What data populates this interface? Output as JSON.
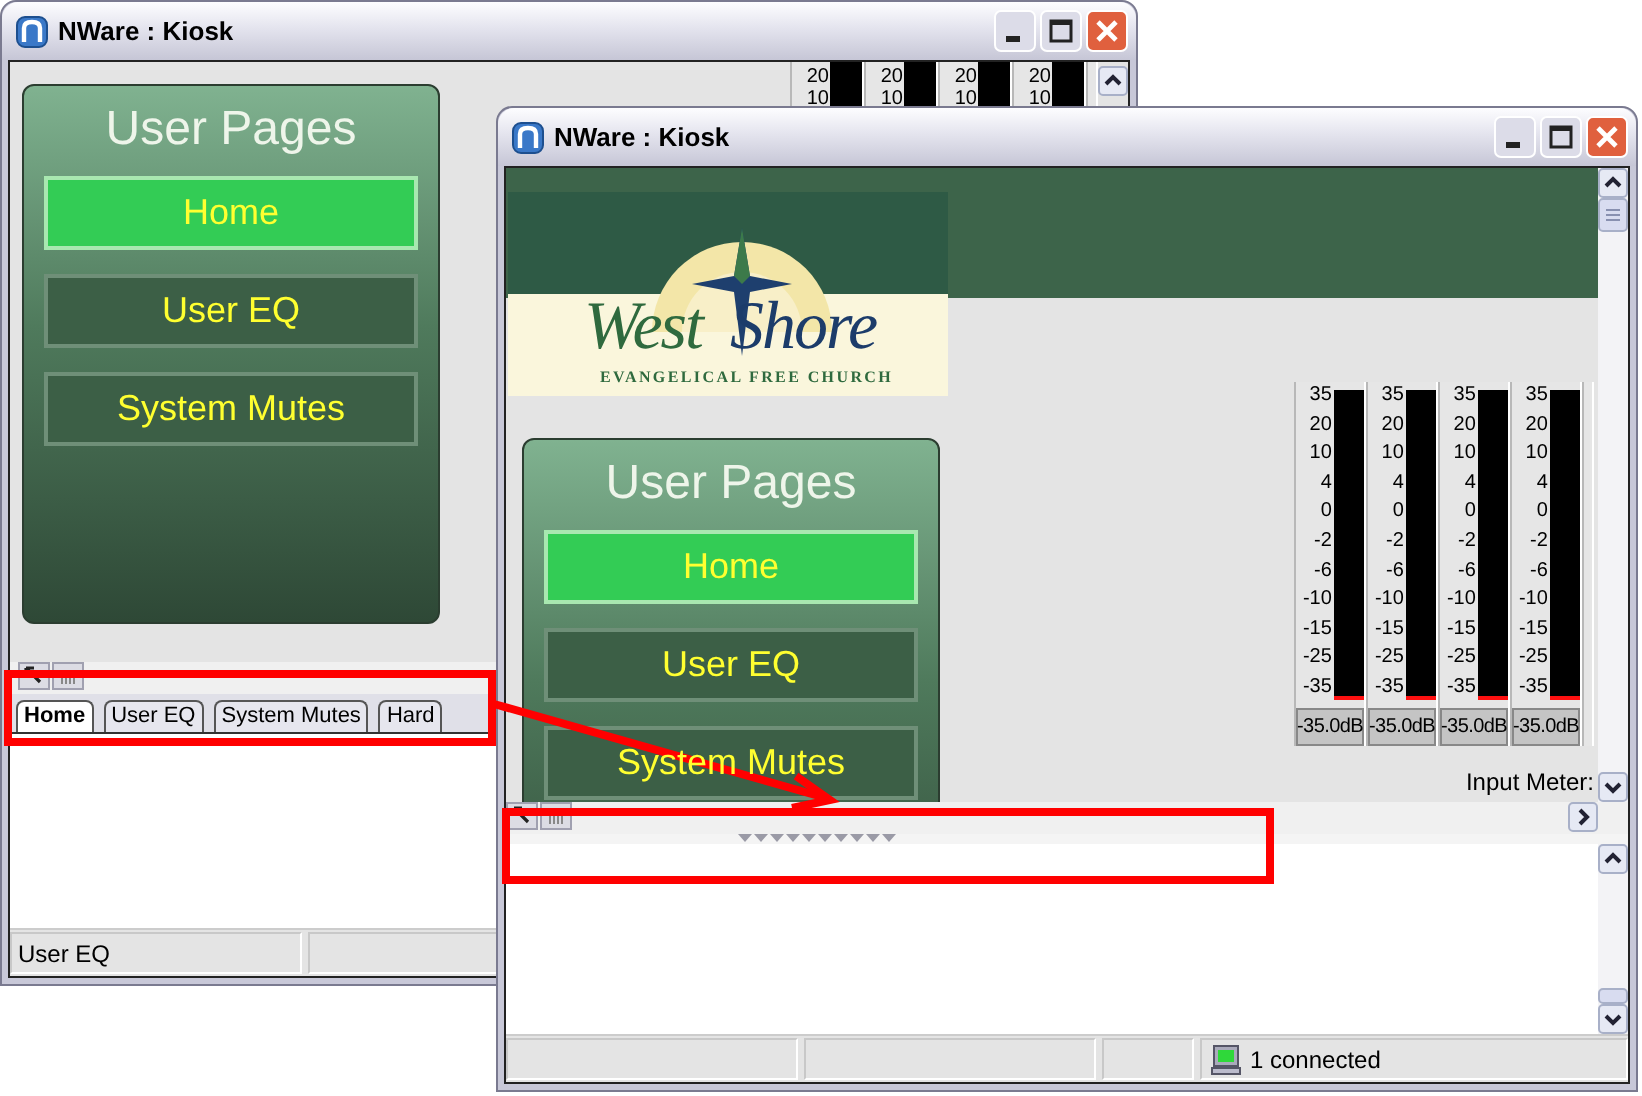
{
  "windows": [
    {
      "title": "NWare : Kiosk",
      "panel": {
        "title": "User Pages",
        "buttons": [
          {
            "label": "Home",
            "selected": true
          },
          {
            "label": "User EQ",
            "selected": false
          },
          {
            "label": "System Mutes",
            "selected": false
          }
        ]
      },
      "meters": [
        {
          "labels": [
            "20",
            "10"
          ]
        },
        {
          "labels": [
            "20",
            "10"
          ]
        },
        {
          "labels": [
            "20",
            "10"
          ]
        },
        {
          "labels": [
            "20",
            "10"
          ]
        }
      ],
      "tabs": [
        {
          "label": "Home",
          "selected": true
        },
        {
          "label": "User EQ",
          "selected": false
        },
        {
          "label": "System Mutes",
          "selected": false
        },
        {
          "label": "Hard",
          "selected": false
        }
      ],
      "status_bar": {
        "text": "User EQ"
      }
    },
    {
      "title": "NWare : Kiosk",
      "logo": {
        "word_1": "West",
        "word_2": "Shore",
        "tagline": "EVANGELICAL FREE CHURCH"
      },
      "panel": {
        "title": "User Pages",
        "buttons": [
          {
            "label": "Home",
            "selected": true
          },
          {
            "label": "User EQ",
            "selected": false
          },
          {
            "label": "System Mutes",
            "selected": false
          }
        ]
      },
      "meters": [
        {
          "labels": [
            "35",
            "20",
            "10",
            "4",
            "0",
            "-2",
            "-6",
            "-10",
            "-15",
            "-25",
            "-35"
          ],
          "level": 0,
          "reading": "-35.0dB"
        },
        {
          "labels": [
            "35",
            "20",
            "10",
            "4",
            "0",
            "-2",
            "-6",
            "-10",
            "-15",
            "-25",
            "-35"
          ],
          "level": 0,
          "reading": "-35.0dB"
        },
        {
          "labels": [
            "35",
            "20",
            "10",
            "4",
            "0",
            "-2",
            "-6",
            "-10",
            "-15",
            "-25",
            "-35"
          ],
          "level": 0,
          "reading": "-35.0dB"
        },
        {
          "labels": [
            "35",
            "20",
            "10",
            "4",
            "0",
            "-2",
            "-6",
            "-10",
            "-15",
            "-25",
            "-35"
          ],
          "level": 0,
          "reading": "-35.0dB"
        }
      ],
      "meter_selector": "Input Meter:",
      "status_bar": {
        "text": "1 connected"
      }
    }
  ]
}
